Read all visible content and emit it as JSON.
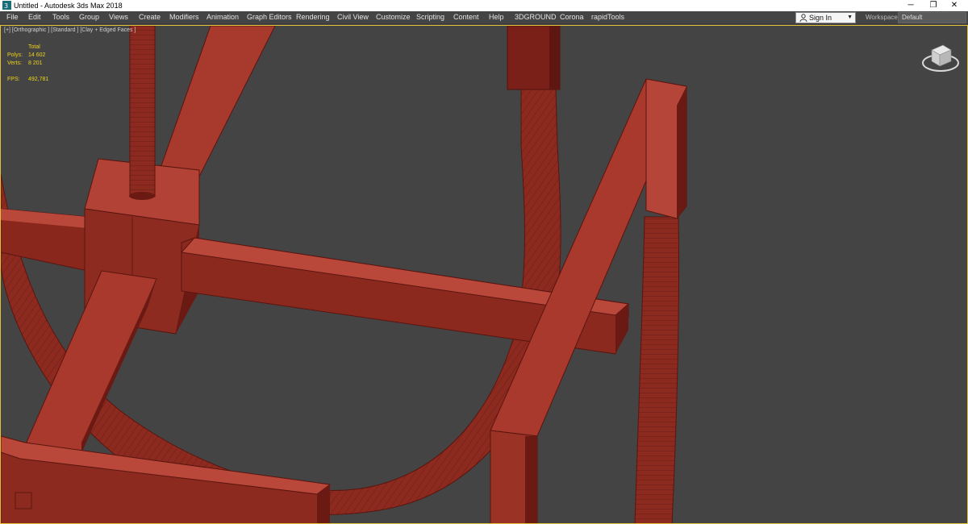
{
  "window": {
    "title": "Untitled - Autodesk 3ds Max 2018",
    "minimize": "─",
    "restore": "❐",
    "close": "✕"
  },
  "menu": {
    "file": "File",
    "edit": "Edit",
    "tools": "Tools",
    "group": "Group",
    "views": "Views",
    "create": "Create",
    "modifiers": "Modifiers",
    "animation": "Animation",
    "graph_editors": "Graph Editors",
    "rendering": "Rendering",
    "civil_view": "Civil View",
    "customize": "Customize",
    "scripting": "Scripting",
    "content": "Content",
    "help": "Help",
    "threedground": "3DGROUND",
    "corona": "Corona",
    "rapidtools": "rapidTools"
  },
  "account": {
    "sign_in": "Sign In",
    "workspaces_label": "Workspaces:",
    "workspace_value": "Default"
  },
  "viewport": {
    "label": "[+] [Orthographic ] [Standard ] [Clay + Edged Faces ]",
    "stats": {
      "total_label": "Total",
      "polys_label": "Polys:",
      "polys_value": "14 602",
      "verts_label": "Verts:",
      "verts_value": "8 201",
      "fps_label": "FPS:",
      "fps_value": "492,781"
    }
  },
  "colors": {
    "model_fill": "#9c3327",
    "model_light": "#c0483a",
    "model_dark": "#6a1a13",
    "viewport_bg": "#444444",
    "stats_text": "#ecd21a",
    "active_border": "#e0c33a"
  },
  "icons": [
    "app-icon",
    "user-icon",
    "chevron-down-icon",
    "viewcube-icon"
  ]
}
